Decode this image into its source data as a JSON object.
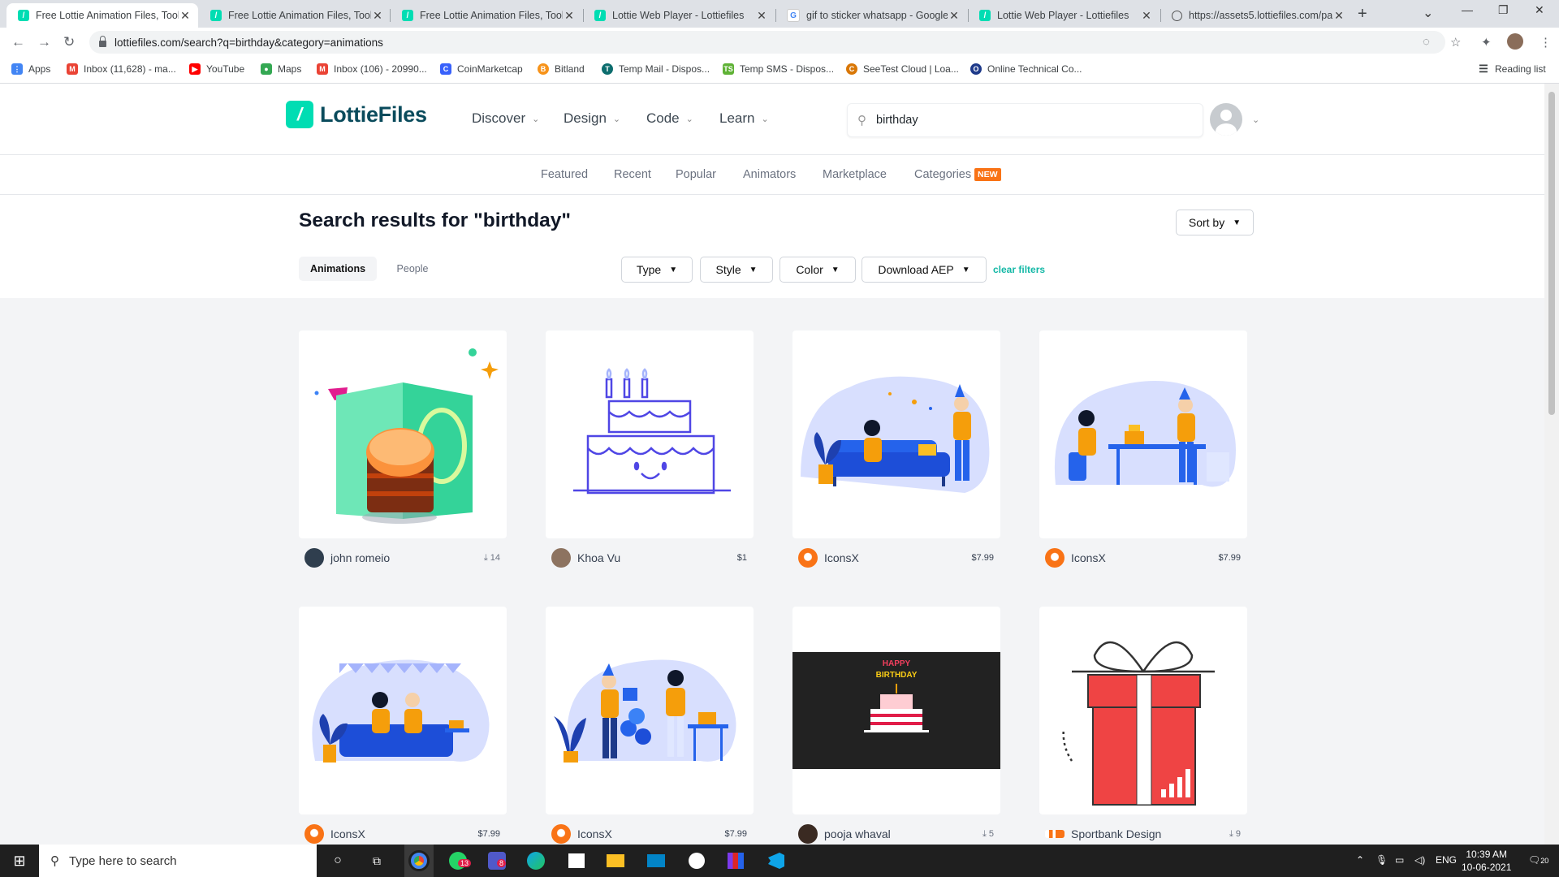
{
  "browser": {
    "tabs": [
      {
        "title": "Free Lottie Animation Files, Tools",
        "icon": "lottie"
      },
      {
        "title": "Free Lottie Animation Files, Tools",
        "icon": "lottie"
      },
      {
        "title": "Free Lottie Animation Files, Tools",
        "icon": "lottie"
      },
      {
        "title": "Lottie Web Player - Lottiefiles",
        "icon": "lottie"
      },
      {
        "title": "gif to sticker whatsapp - Google",
        "icon": "google"
      },
      {
        "title": "Lottie Web Player - Lottiefiles",
        "icon": "lottie"
      },
      {
        "title": "https://assets5.lottiefiles.com/pa",
        "icon": "globe"
      }
    ],
    "url": "lottiefiles.com/search?q=birthday&category=animations",
    "bookmarks": [
      {
        "label": "Apps",
        "icon": "apps-grid-icon",
        "color": "#4285f4"
      },
      {
        "label": "Inbox (11,628) - ma...",
        "icon": "gmail-icon",
        "color": "#ea4335"
      },
      {
        "label": "YouTube",
        "icon": "youtube-icon",
        "color": "#ff0000"
      },
      {
        "label": "Maps",
        "icon": "maps-icon",
        "color": "#34a853"
      },
      {
        "label": "Inbox (106) - 20990...",
        "icon": "gmail-icon",
        "color": "#ea4335"
      },
      {
        "label": "CoinMarketcap",
        "icon": "coinmarketcap-icon",
        "color": "#3861fb"
      },
      {
        "label": "Bitland",
        "icon": "bitland-icon",
        "color": "#f7931a"
      },
      {
        "label": "Temp Mail - Dispos...",
        "icon": "tempmail-icon",
        "color": "#0d6d6e"
      },
      {
        "label": "Temp SMS - Dispos...",
        "icon": "tempsms-icon",
        "color": "#5fb236"
      },
      {
        "label": "SeeTest Cloud | Loa...",
        "icon": "seetest-icon",
        "color": "#d97706"
      },
      {
        "label": "Online Technical Co...",
        "icon": "technical-icon",
        "color": "#1e3a8a"
      }
    ],
    "reading_list": "Reading list"
  },
  "site": {
    "logo": "LottieFiles",
    "nav": [
      "Discover",
      "Design",
      "Code",
      "Learn"
    ],
    "search_value": "birthday",
    "subnav": [
      "Featured",
      "Recent",
      "Popular",
      "Animators",
      "Marketplace",
      "Categories"
    ],
    "new_badge": "NEW",
    "results_title": "Search results for \"birthday\"",
    "sort_label": "Sort by",
    "tabs": [
      "Animations",
      "People"
    ],
    "filters": [
      "Type",
      "Style",
      "Color",
      "Download AEP"
    ],
    "clear_filters": "clear filters",
    "accent": "#00ddb3",
    "cards": [
      {
        "author": "john romeio",
        "value": "14",
        "kind": "downloads",
        "art": "card-cake"
      },
      {
        "author": "Khoa Vu",
        "value": "$1",
        "kind": "price",
        "art": "cake-outline"
      },
      {
        "author": "IconsX",
        "value": "$7.99",
        "kind": "price",
        "art": "party-sofa"
      },
      {
        "author": "IconsX",
        "value": "$7.99",
        "kind": "price",
        "art": "party-table"
      },
      {
        "author": "IconsX",
        "value": "$7.99",
        "kind": "price",
        "art": "party-couch"
      },
      {
        "author": "IconsX",
        "value": "$7.99",
        "kind": "price",
        "art": "party-balloons"
      },
      {
        "author": "pooja whaval",
        "value": "5",
        "kind": "downloads",
        "art": "happy-birthday-cake"
      },
      {
        "author": "Sportbank Design",
        "value": "9",
        "kind": "downloads",
        "art": "gift-box"
      }
    ],
    "card_art_text": {
      "happy": "HAPPY",
      "birthday": "BIRTHDAY"
    }
  },
  "taskbar": {
    "search_placeholder": "Type here to search",
    "lang": "ENG",
    "time": "10:39 AM",
    "date": "10-06-2021",
    "whatsapp_badge": "13",
    "teams_badge": "8",
    "notifications": "20"
  }
}
